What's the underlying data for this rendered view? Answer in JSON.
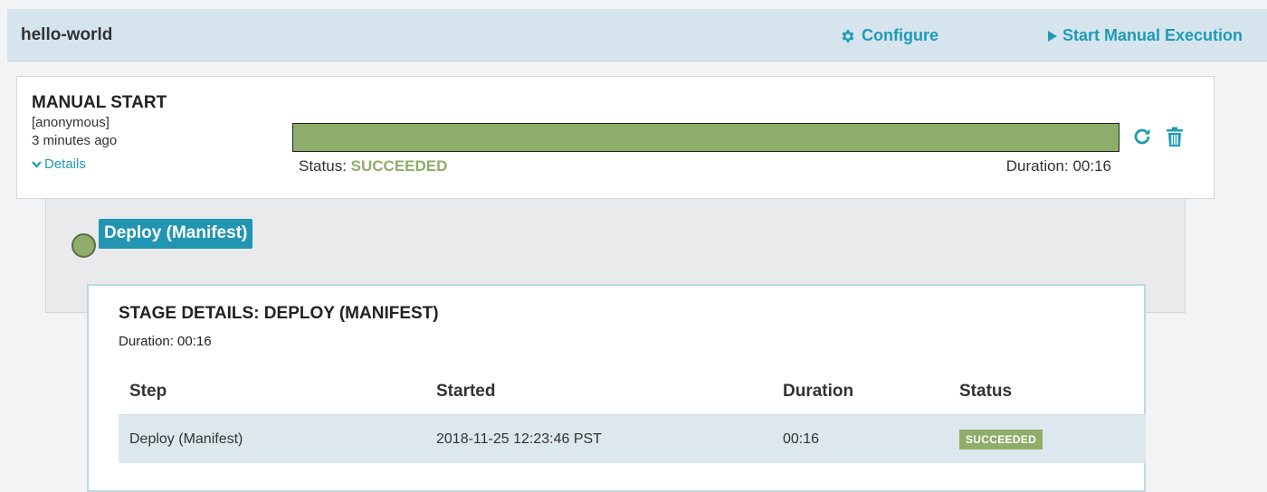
{
  "header": {
    "app_title": "hello-world",
    "configure_label": "Configure",
    "start_label": "Start Manual Execution",
    "accent_color": "#1f9bb7"
  },
  "execution": {
    "trigger_title": "MANUAL START",
    "user": "[anonymous]",
    "time_ago": "3 minutes ago",
    "details_label": "Details",
    "progress_fraction": 1.0,
    "status_prefix": "Status:",
    "status_value": "SUCCEEDED",
    "duration_text": "Duration: 00:16",
    "success_color": "#8fad6a"
  },
  "stage": {
    "label": "Deploy (Manifest)"
  },
  "stage_details": {
    "title": "STAGE DETAILS: DEPLOY (MANIFEST)",
    "duration_text": "Duration: 00:16",
    "columns": [
      "Step",
      "Started",
      "Duration",
      "Status"
    ],
    "rows": [
      {
        "step": "Deploy (Manifest)",
        "started": "2018-11-25 12:23:46 PST",
        "duration": "00:16",
        "status": "SUCCEEDED"
      }
    ]
  }
}
